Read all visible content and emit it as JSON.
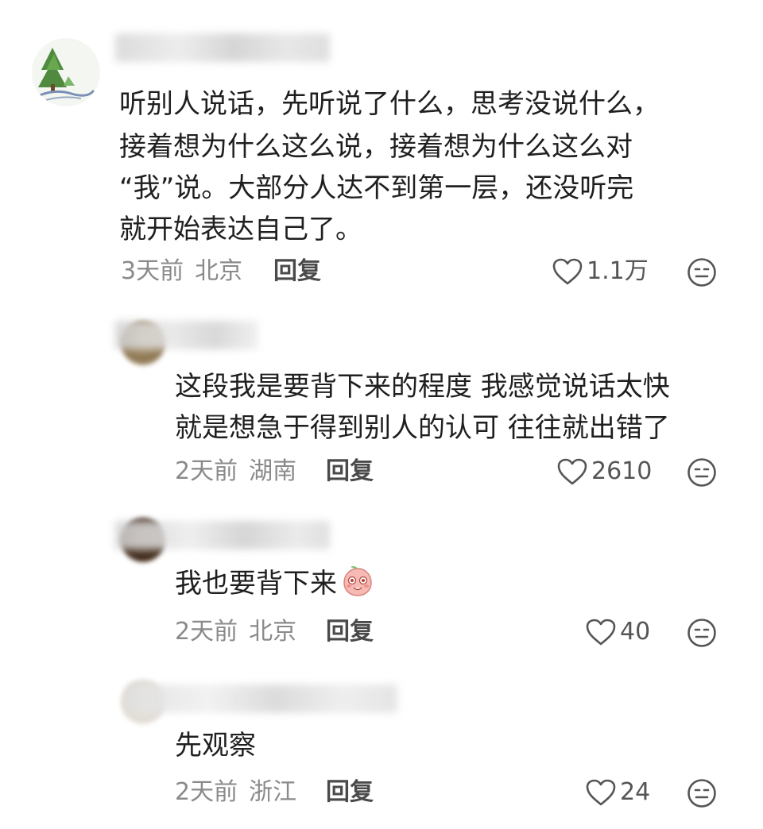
{
  "comments": [
    {
      "text_lines": [
        "听别人说话，先听说了什么，思考没说什么，",
        "接着想为什么这么说，接着想为什么这么对",
        "“我”说。大部分人达不到第一层，还没听完",
        "就开始表达自己了。"
      ],
      "time": "3天前",
      "location": "北京",
      "reply_label": "回复",
      "likes": "1.1万",
      "avatar_icon": "tree-landscape-avatar-icon",
      "like_icon": "heart-outline-icon",
      "dislike_icon": "neutral-face-icon"
    },
    {
      "text_lines": [
        "这段我是要背下来的程度 我感觉说话太快",
        "就是想急于得到别人的认可 往往就出错了"
      ],
      "time": "2天前",
      "location": "湖南",
      "reply_label": "回复",
      "likes": "2610",
      "like_icon": "heart-outline-icon",
      "dislike_icon": "neutral-face-icon"
    },
    {
      "text_lines": [
        "我也要背下来"
      ],
      "emoji": "blushing-peach-emoji",
      "time": "2天前",
      "location": "北京",
      "reply_label": "回复",
      "likes": "40",
      "like_icon": "heart-outline-icon",
      "dislike_icon": "neutral-face-icon"
    },
    {
      "text_lines": [
        "先观察"
      ],
      "time": "2天前",
      "location": "浙江",
      "reply_label": "回复",
      "likes": "24",
      "like_icon": "heart-outline-icon",
      "dislike_icon": "neutral-face-icon"
    }
  ],
  "colors": {
    "text": "#1f1f1f",
    "meta": "#8a8a8a",
    "reply": "#4a4a4a",
    "icon": "#555555"
  }
}
